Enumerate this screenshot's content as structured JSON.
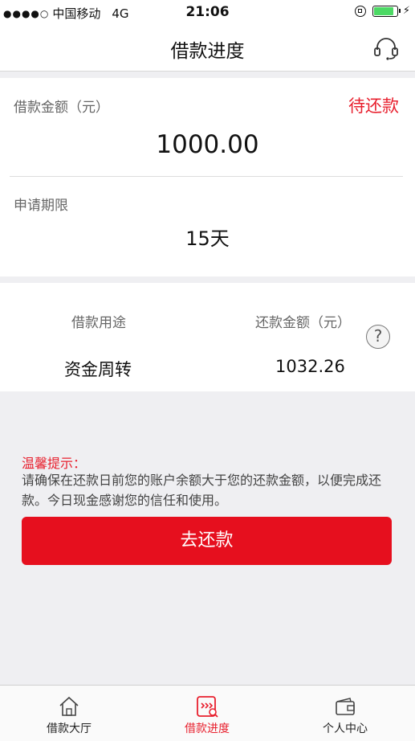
{
  "status_bar": {
    "signal_dots": "●●●●○",
    "carrier": "中国移动",
    "network": "4G",
    "time": "21:06",
    "battery_level": 0.85
  },
  "nav": {
    "title": "借款进度",
    "service_icon": "headset-icon"
  },
  "loan": {
    "amount_label": "借款金额（元）",
    "status": "待还款",
    "amount": "1000.00",
    "term_label": "申请期限",
    "term": "15天"
  },
  "details": {
    "purpose_label": "借款用途",
    "repay_label": "还款金额（元）",
    "purpose": "资金周转",
    "repay_amount": "1032.26",
    "help": "?"
  },
  "tip": {
    "title": "温馨提示：",
    "text": "请确保在还款日前您的账户余额大于您的还款金额，以便完成还款。今日现金感谢您的信任和使用。"
  },
  "repay_button": "去还款",
  "tabs": [
    {
      "label": "借款大厅",
      "icon": "home-icon"
    },
    {
      "label": "借款进度",
      "icon": "progress-icon"
    },
    {
      "label": "个人中心",
      "icon": "wallet-icon"
    }
  ],
  "colors": {
    "accent": "#e60f1e",
    "active_tab": "#e8202e",
    "battery": "#4cd964"
  }
}
